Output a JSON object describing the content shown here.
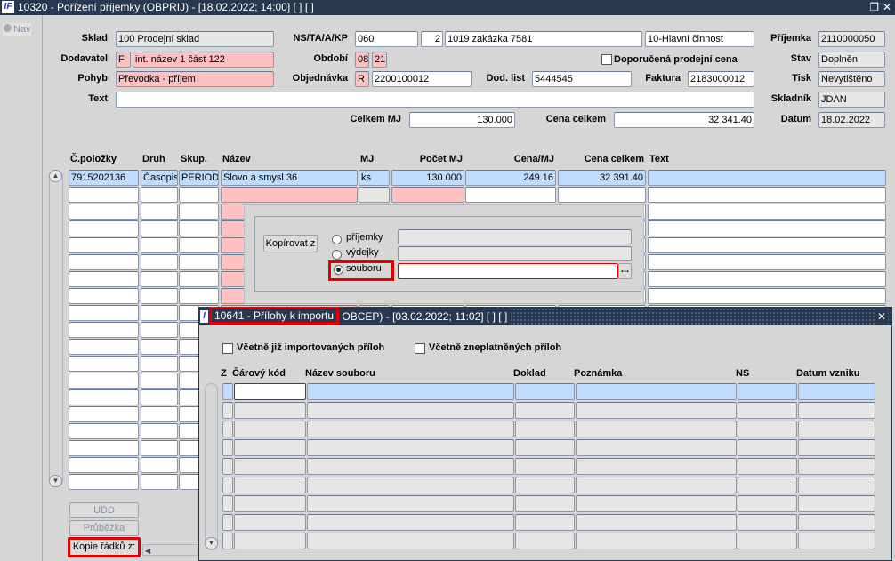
{
  "window": {
    "title": "10320 - Pořízení příjemky (OBPRIJ) - [18.02.2022; 14:00]  [ ]  [ ]",
    "logo": "IF"
  },
  "nav": {
    "label": "Nav"
  },
  "form": {
    "sklad": {
      "label": "Sklad",
      "value": "100 Prodejní sklad"
    },
    "ns": {
      "label": "NS/TA/A/KP",
      "ns": "060",
      "ta": "2",
      "a": "1019 zakázka 7581",
      "kp": "10-Hlavní činnost"
    },
    "prijemka": {
      "label": "Příjemka",
      "value": "2110000050"
    },
    "dodavatel": {
      "label": "Dodavatel",
      "code": "F",
      "value": "int. název 1 část 122"
    },
    "obdobi": {
      "label": "Období",
      "month": "08",
      "year": "21"
    },
    "doporucena": {
      "label": "Doporučená prodejní cena",
      "checked": false
    },
    "stav": {
      "label": "Stav",
      "value": "Doplněn"
    },
    "pohyb": {
      "label": "Pohyb",
      "value": "Převodka - příjem"
    },
    "objednavka": {
      "label": "Objednávka",
      "code": "R",
      "value": "2200100012"
    },
    "dodlist": {
      "label": "Dod. list",
      "value": "5444545"
    },
    "faktura": {
      "label": "Faktura",
      "value": "2183000012"
    },
    "tisk": {
      "label": "Tisk",
      "value": "Nevytištěno"
    },
    "text": {
      "label": "Text",
      "value": ""
    },
    "skladnik": {
      "label": "Skladník",
      "value": "JDAN"
    },
    "celkemmj": {
      "label": "Celkem MJ",
      "value": "130.000"
    },
    "cenacelkem": {
      "label": "Cena celkem",
      "value": "32 341.40"
    },
    "datum": {
      "label": "Datum",
      "value": "18.02.2022"
    }
  },
  "table": {
    "columns": [
      "Č.položky",
      "Druh",
      "Skup.",
      "Název",
      "MJ",
      "Počet MJ",
      "Cena/MJ",
      "Cena celkem",
      "Text"
    ],
    "rows": [
      [
        "7915202136",
        "Časopis",
        "PERIODIK",
        "Slovo a smysl 36",
        "ks",
        "130.000",
        "249.16",
        "32 391.40",
        ""
      ]
    ]
  },
  "buttons": {
    "udd": "UDD",
    "prubezka": "Průběžka",
    "kopie": "Kopie řádků z:"
  },
  "copy_dialog": {
    "button": "Kopírovat z",
    "options": [
      "příjemky",
      "výdejky",
      "souboru"
    ],
    "selected": "souboru",
    "browse": "..."
  },
  "sub_window": {
    "title_highlight": "10641 - Přílohy k importu",
    "title_rest": " OBCEP) - [03.02.2022; 11:02]  [ ]  [ ]",
    "close": "✕",
    "checkbox1": "Včetně již importovaných příloh",
    "checkbox2": "Včetně zneplatněných příloh",
    "columns": [
      "Z",
      "Čárový kód",
      "Název souboru",
      "Doklad",
      "Poznámka",
      "NS",
      "Datum vzniku"
    ]
  },
  "colors": {
    "titlebar": "#283850",
    "highlight": "#e00000",
    "selected_row": "#bfdcff",
    "required": "#ffc0c0"
  }
}
